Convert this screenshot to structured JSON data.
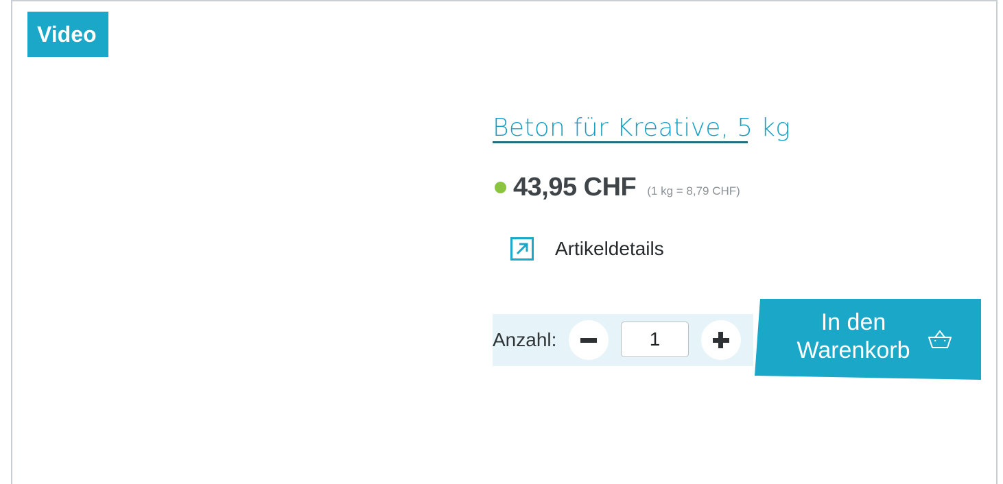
{
  "badge": {
    "label": "Video"
  },
  "product": {
    "title": "Beton für Kreative, 5 kg",
    "price": "43,95 CHF",
    "unit_price": "(1 kg = 8,79 CHF)",
    "details_label": "Artikeldetails",
    "details_icon": "external-link-arrow-icon"
  },
  "quantity": {
    "label": "Anzahl:",
    "value": "1",
    "decrement_icon": "minus-icon",
    "increment_icon": "plus-icon"
  },
  "cart": {
    "label_line1": "In den",
    "label_line2": "Warenkorb",
    "icon": "shopping-basket-icon"
  },
  "colors": {
    "accent": "#1ba7c8",
    "title": "#1a9fc4",
    "stock_dot": "#8bc43f",
    "quantity_band": "#e6f4f9"
  }
}
